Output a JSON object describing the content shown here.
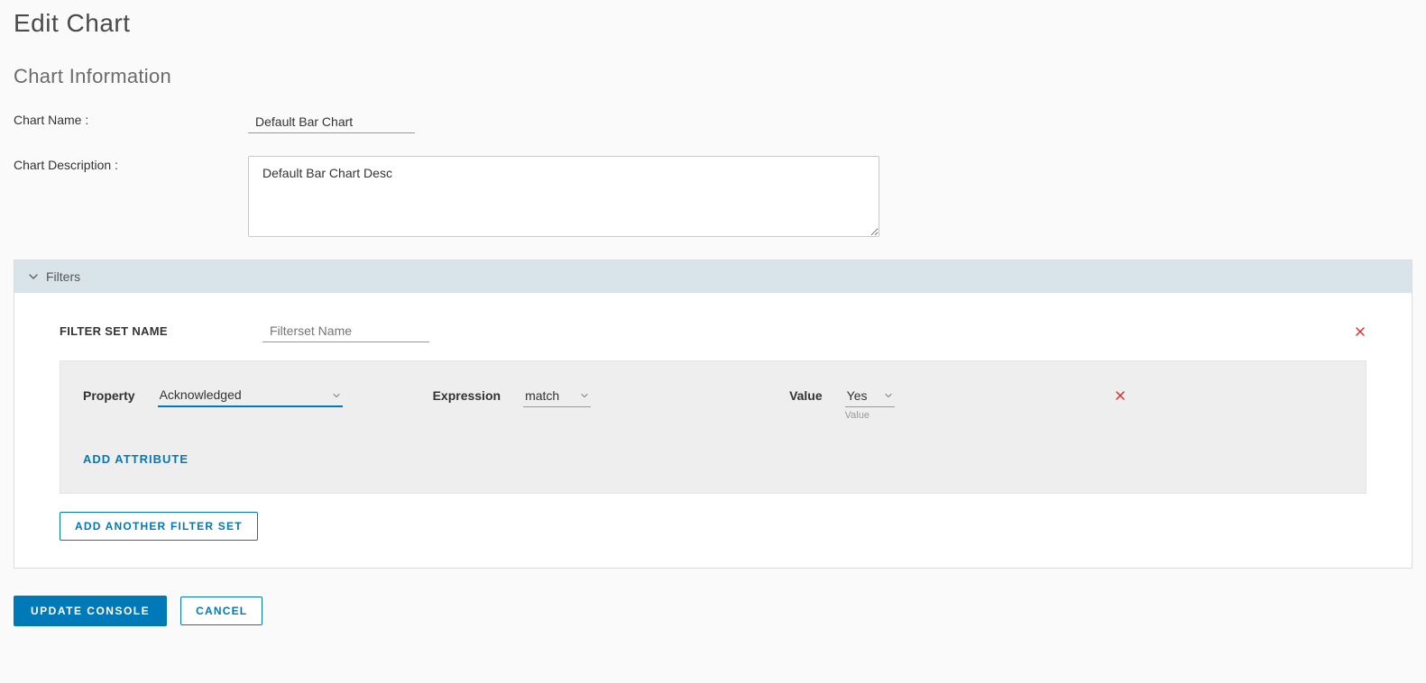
{
  "page_title": "Edit Chart",
  "section_heading": "Chart Information",
  "labels": {
    "chart_name": "Chart Name :",
    "chart_description": "Chart Description :",
    "filter_set_name": "FILTER SET NAME",
    "property": "Property",
    "expression": "Expression",
    "value": "Value",
    "value_helper": "Value"
  },
  "values": {
    "chart_name": "Default Bar Chart",
    "chart_description": "Default Bar Chart Desc",
    "filterset_name_placeholder": "Filterset Name",
    "property_selected": "Acknowledged",
    "expression_selected": "match",
    "value_selected": "Yes"
  },
  "panel": {
    "filters_title": "Filters"
  },
  "actions": {
    "add_attribute": "ADD ATTRIBUTE",
    "add_filter_set": "ADD ANOTHER FILTER SET",
    "update": "UPDATE CONSOLE",
    "cancel": "CANCEL"
  }
}
